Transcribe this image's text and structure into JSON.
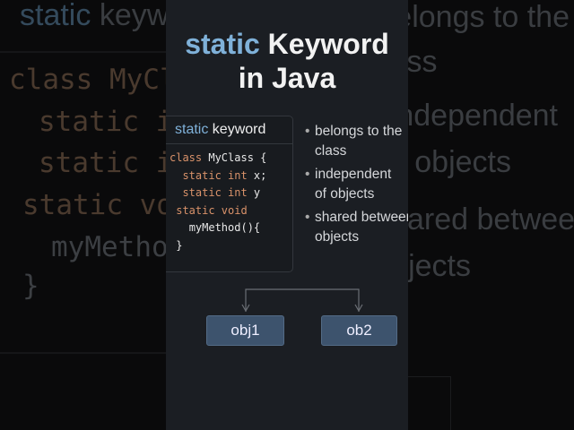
{
  "title": {
    "highlight": "static",
    "rest": "Keyword",
    "line2": "in Java"
  },
  "card": {
    "header_highlight": "static",
    "header_rest": "keyword",
    "code": [
      {
        "kw": "",
        "text": "class MyClass {",
        "indent": "",
        "kwfirst": "class",
        "after": " MyClass {"
      },
      {
        "indent": "  ",
        "kw": "static int",
        "after": " x;"
      },
      {
        "indent": "  ",
        "kw": "static int",
        "after": " y"
      },
      {
        "indent": " ",
        "kw": "static void",
        "after": ""
      },
      {
        "indent": "   ",
        "kw": "",
        "after": "myMethod(){"
      },
      {
        "indent": " ",
        "kw": "",
        "after": "}"
      }
    ]
  },
  "bullets": [
    {
      "l1": "belongs to the",
      "l2": "class"
    },
    {
      "l1": "independent",
      "l2": "of objects"
    },
    {
      "l1": "shared between",
      "l2": "objects"
    }
  ],
  "objects": [
    "obj1",
    "ob2"
  ],
  "background": {
    "left_code": [
      "class MyCl",
      "static i",
      "static i",
      "static voi",
      "myMetho",
      "}"
    ]
  },
  "colors": {
    "accent": "#7fb1d9",
    "keyword": "#d9926a",
    "object_box": "#3d536d"
  }
}
